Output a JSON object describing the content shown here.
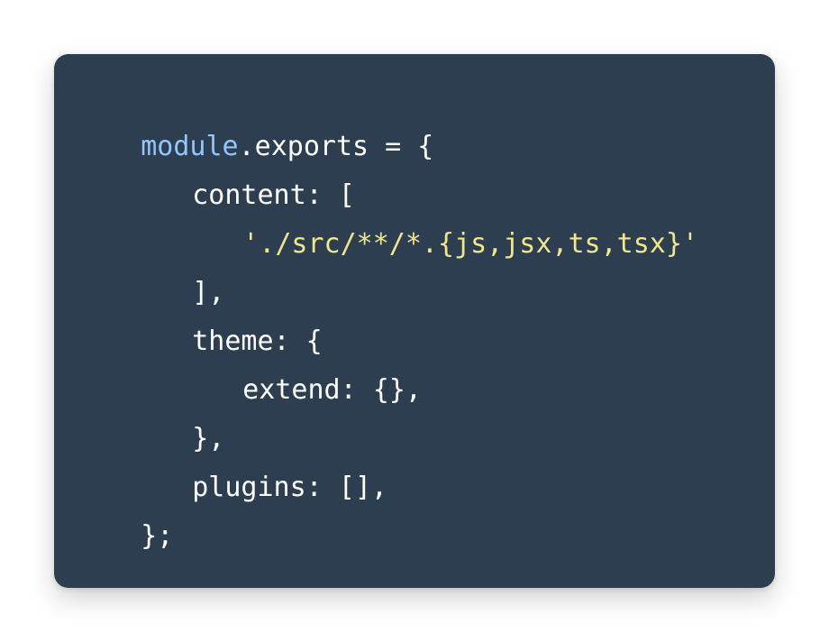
{
  "code_block": {
    "theme": {
      "background": "#2c3e50",
      "text": "#ffffff",
      "keyword": "#93c5fd",
      "string": "#f0e68c"
    },
    "lines": [
      {
        "indent": 0,
        "tokens": [
          {
            "type": "keyword",
            "text": "module"
          },
          {
            "type": "plain",
            "text": ".exports = {"
          }
        ]
      },
      {
        "indent": 1,
        "tokens": [
          {
            "type": "plain",
            "text": "content: ["
          }
        ]
      },
      {
        "indent": 2,
        "tokens": [
          {
            "type": "string",
            "text": "'./src/**/*.{js,jsx,ts,tsx}'"
          }
        ]
      },
      {
        "indent": 1,
        "tokens": [
          {
            "type": "plain",
            "text": "],"
          }
        ]
      },
      {
        "indent": 1,
        "tokens": [
          {
            "type": "plain",
            "text": "theme: {"
          }
        ]
      },
      {
        "indent": 2,
        "tokens": [
          {
            "type": "plain",
            "text": "extend: {},"
          }
        ]
      },
      {
        "indent": 1,
        "tokens": [
          {
            "type": "plain",
            "text": "},"
          }
        ]
      },
      {
        "indent": 1,
        "tokens": [
          {
            "type": "plain",
            "text": "plugins: [],"
          }
        ]
      },
      {
        "indent": 0,
        "tokens": [
          {
            "type": "plain",
            "text": "};"
          }
        ]
      }
    ]
  }
}
